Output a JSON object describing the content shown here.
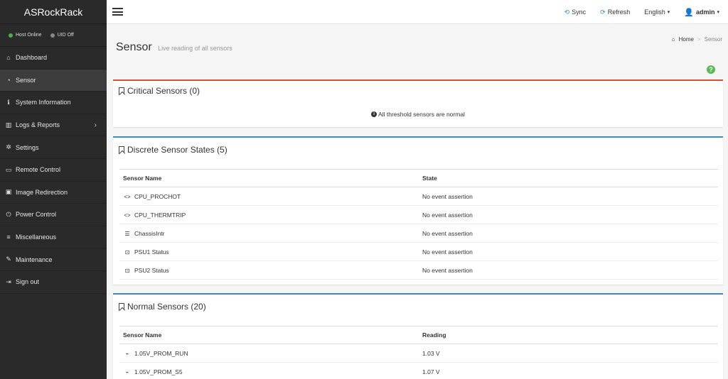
{
  "brand": "ASRockRack",
  "status": {
    "host": "Host Online",
    "uid": "UID Off",
    "host_color": "#4caf50",
    "uid_color": "#888888"
  },
  "nav": [
    {
      "label": "Dashboard",
      "icon": "home-icon",
      "glyph": "⌂"
    },
    {
      "label": "Sensor",
      "icon": "dashboard-gauge-icon",
      "glyph": "◔",
      "active": true
    },
    {
      "label": "System Information",
      "icon": "info-circle-icon",
      "glyph": "ℹ"
    },
    {
      "label": "Logs & Reports",
      "icon": "bar-chart-icon",
      "glyph": "▥",
      "chevron": "›"
    },
    {
      "label": "Settings",
      "icon": "gear-icon",
      "glyph": "✲"
    },
    {
      "label": "Remote Control",
      "icon": "monitor-icon",
      "glyph": "▭"
    },
    {
      "label": "Image Redirection",
      "icon": "image-icon",
      "glyph": "▣"
    },
    {
      "label": "Power Control",
      "icon": "power-icon",
      "glyph": "⏻"
    },
    {
      "label": "Miscellaneous",
      "icon": "list-icon",
      "glyph": "≡"
    },
    {
      "label": "Maintenance",
      "icon": "wrench-icon",
      "glyph": "✎"
    },
    {
      "label": "Sign out",
      "icon": "sign-out-icon",
      "glyph": "⇥"
    }
  ],
  "topbar": {
    "sync": "Sync",
    "refresh": "Refresh",
    "language": "English",
    "user": "admin"
  },
  "page": {
    "title": "Sensor",
    "subtitle": "Live reading of all sensors",
    "breadcrumb_home": "Home",
    "breadcrumb_sep": ">",
    "breadcrumb_current": "Sensor"
  },
  "critical": {
    "title": "Critical Sensors (0)",
    "notice": "All threshold sensors are normal",
    "color": "#dd4b39"
  },
  "discrete": {
    "title": "Discrete Sensor States (5)",
    "col_name": "Sensor Name",
    "col_state": "State",
    "color": "#3c8dbc",
    "rows": [
      {
        "name": "CPU_PROCHOT",
        "state": "No event assertion",
        "glyph": "<>",
        "icon": "code-icon"
      },
      {
        "name": "CPU_THERMTRIP",
        "state": "No event assertion",
        "glyph": "<>",
        "icon": "code-icon"
      },
      {
        "name": "ChassisIntr",
        "state": "No event assertion",
        "glyph": "☰",
        "icon": "server-icon"
      },
      {
        "name": "PSU1 Status",
        "state": "No event assertion",
        "glyph": "⊡",
        "icon": "power-supply-icon"
      },
      {
        "name": "PSU2 Status",
        "state": "No event assertion",
        "glyph": "⊡",
        "icon": "power-supply-icon"
      }
    ]
  },
  "normal": {
    "title": "Normal Sensors (20)",
    "col_name": "Sensor Name",
    "col_reading": "Reading",
    "color": "#3c8dbc",
    "rows": [
      {
        "name": "1.05V_PROM_RUN",
        "reading": "1.03 V",
        "glyph": "⌁",
        "icon": "pulse-icon"
      },
      {
        "name": "1.05V_PROM_S5",
        "reading": "1.07 V",
        "glyph": "⌁",
        "icon": "pulse-icon"
      }
    ]
  }
}
